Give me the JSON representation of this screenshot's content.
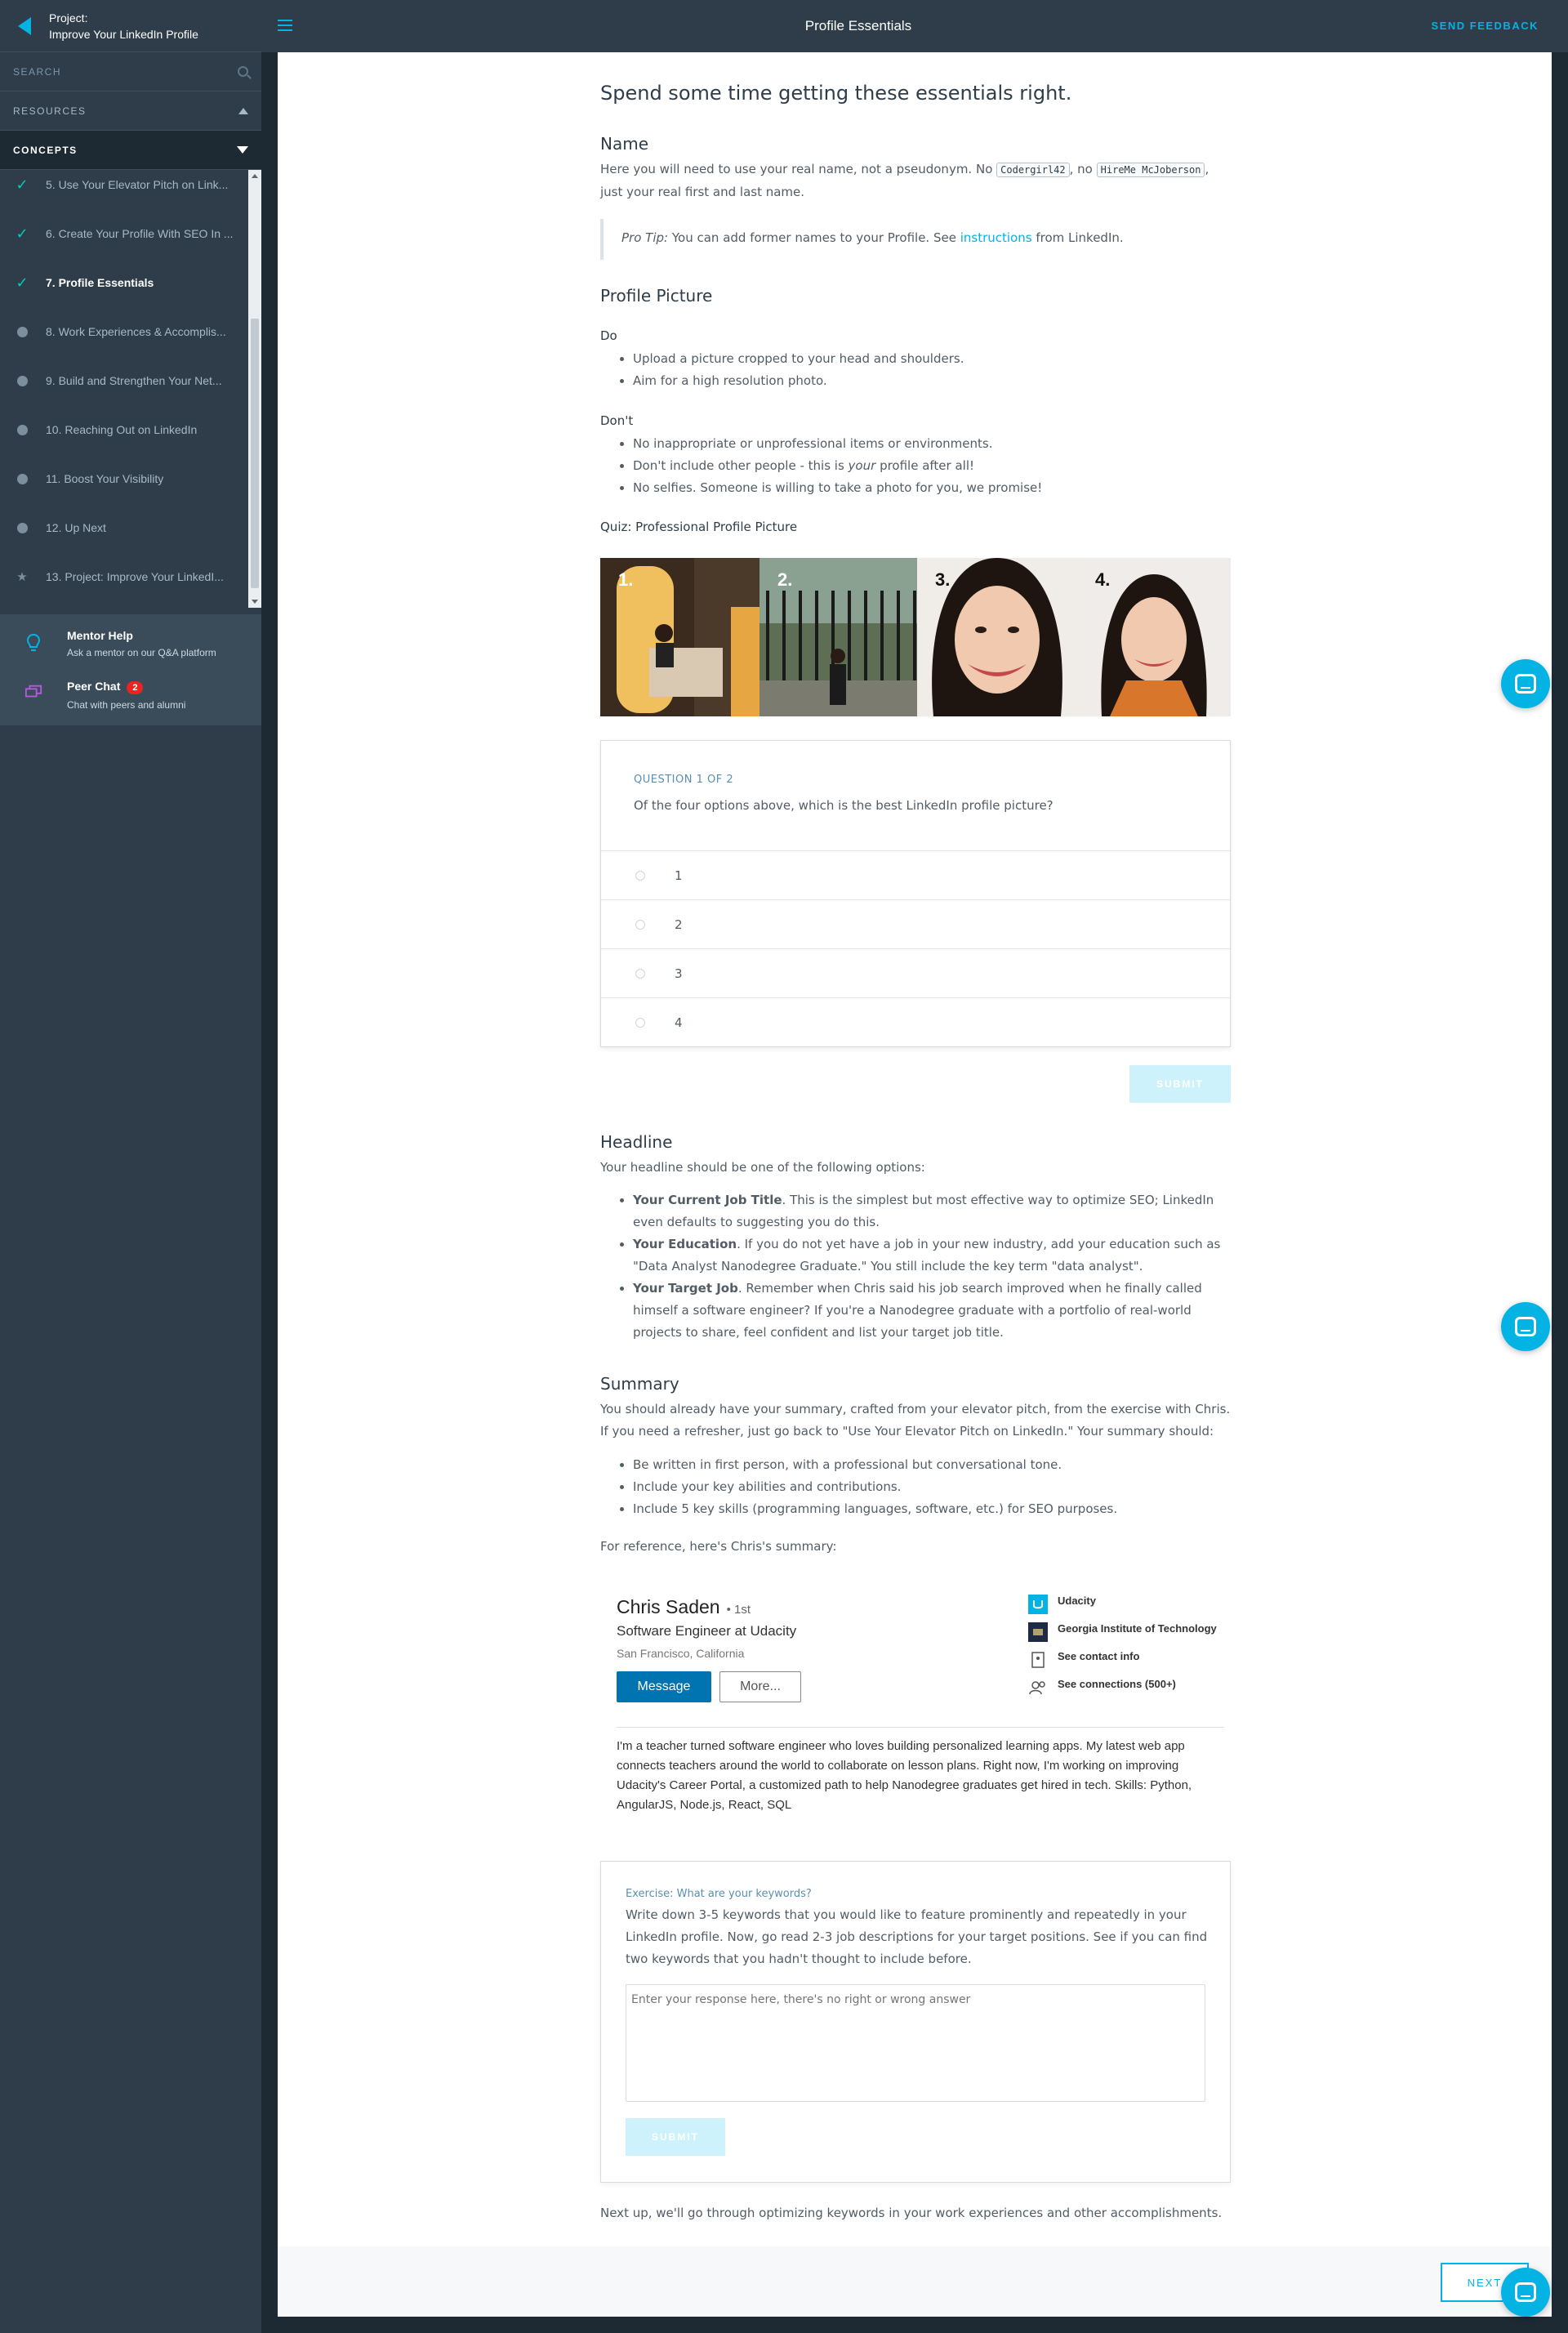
{
  "sidebar": {
    "project_label": "Project:",
    "project_name": "Improve Your LinkedIn Profile",
    "search_label": "SEARCH",
    "resources_label": "RESOURCES",
    "concepts_label": "CONCEPTS",
    "concepts": [
      {
        "label": "5. Use Your Elevator Pitch on Link...",
        "status": "done"
      },
      {
        "label": "6. Create Your Profile With SEO In ...",
        "status": "done"
      },
      {
        "label": "7. Profile Essentials",
        "status": "current"
      },
      {
        "label": "8. Work Experiences & Accomplis...",
        "status": "todo"
      },
      {
        "label": "9. Build and Strengthen Your Net...",
        "status": "todo"
      },
      {
        "label": "10. Reaching Out on LinkedIn",
        "status": "todo"
      },
      {
        "label": "11. Boost Your Visibility",
        "status": "todo"
      },
      {
        "label": "12. Up Next",
        "status": "todo"
      },
      {
        "label": "13. Project: Improve Your LinkedI...",
        "status": "project"
      }
    ],
    "mentor_title": "Mentor Help",
    "mentor_sub": "Ask a mentor on our Q&A platform",
    "peer_title": "Peer Chat",
    "peer_badge": "2",
    "peer_sub": "Chat with peers and alumni"
  },
  "topbar": {
    "title": "Profile Essentials",
    "feedback": "SEND FEEDBACK"
  },
  "content": {
    "page_title": "Spend some time getting these essentials right.",
    "name_heading": "Name",
    "name_p1": "Here you will need to use your real name, not a pseudonym. No",
    "code1": "Codergirl42",
    "name_p2": ", no",
    "code2": "HireMe McJoberson",
    "name_p3": ",",
    "name_p4": "just your real first and last name.",
    "protip_label": "Pro Tip:",
    "protip_text": "You can add former names to your Profile. See",
    "protip_link": "instructions",
    "protip_end": "from LinkedIn.",
    "pic_heading": "Profile Picture",
    "do_label": "Do",
    "do_items": [
      "Upload a picture cropped to your head and shoulders.",
      "Aim for a high resolution photo."
    ],
    "dont_label": "Don't",
    "dont_1": "No inappropriate or unprofessional items or environments.",
    "dont_2a": "Don't include other people - this is",
    "dont_2b": "your",
    "dont_2c": "profile after all!",
    "dont_3": "No selfies. Someone is willing to take a photo for you, we promise!",
    "quiz_label": "Quiz: Professional Profile Picture",
    "photo_nums": [
      "1.",
      "2.",
      "3.",
      "4."
    ],
    "question_num": "QUESTION 1 OF 2",
    "question": "Of the four options above, which is the best LinkedIn profile picture?",
    "options": [
      "1",
      "2",
      "3",
      "4"
    ],
    "submit": "SUBMIT",
    "headline_heading": "Headline",
    "headline_intro": "Your headline should be one of the following options:",
    "h1_bold": "Your Current Job Title",
    "h1_text": ". This is the simplest but most effective way to optimize SEO; LinkedIn even defaults to suggesting you do this.",
    "h2_bold": "Your Education",
    "h2_text": ". If you do not yet have a job in your new industry, add your education such as \"Data Analyst Nanodegree Graduate.\" You still include the key term \"data analyst\".",
    "h3_bold": "Your Target Job",
    "h3_text": ". Remember when Chris said his job search improved when he finally called himself a software engineer? If you're a Nanodegree graduate with a portfolio of real-world projects to share, feel confident and list your target job title.",
    "summary_heading": "Summary",
    "summary_intro": "You should already have your summary, crafted from your elevator pitch, from the exercise with Chris. If you need a refresher, just go back to \"Use Your Elevator Pitch on LinkedIn.\" Your summary should:",
    "summary_items": [
      "Be written in first person, with a professional but conversational tone.",
      "Include your key abilities and contributions.",
      "Include 5 key skills (programming languages, software, etc.) for SEO purposes."
    ],
    "reference": "For reference, here's Chris's summary:",
    "next_up": "Next up, we'll go through optimizing keywords in your work experiences and other accomplishments.",
    "next_button": "NEXT"
  },
  "profile_card": {
    "name": "Chris Saden",
    "degree": "• 1st",
    "job": "Software Engineer at Udacity",
    "location": "San Francisco, California",
    "message": "Message",
    "more": "More...",
    "company": "Udacity",
    "school": "Georgia Institute of Technology",
    "contact": "See contact info",
    "connections": "See connections (500+)",
    "about": "I'm a teacher turned software engineer who loves building personalized learning apps. My latest web app connects teachers around the world to collaborate on lesson plans. Right now, I'm working on improving Udacity's Career Portal, a customized path to help Nanodegree graduates get hired in tech. Skills: Python, AngularJS, Node.js, React, SQL"
  },
  "exercise": {
    "label": "Exercise: What are your keywords?",
    "text": "Write down 3-5 keywords that you would like to feature prominently and repeatedly in your LinkedIn profile. Now, go read 2-3 job descriptions for your target positions. See if you can find two keywords that you hadn't thought to include before.",
    "placeholder": "Enter your response here, there's no right or wrong answer",
    "submit": "SUBMIT"
  },
  "colors": {
    "accent": "#02b3e4",
    "sidebar": "#2e3d49",
    "check": "#02ccba"
  },
  "icons": [
    "back-arrow-icon",
    "search-icon",
    "lightbulb-icon",
    "chat-bubbles-icon",
    "hamburger-menu-icon",
    "checkmark-icon",
    "star-icon",
    "chat-widget-icon"
  ]
}
